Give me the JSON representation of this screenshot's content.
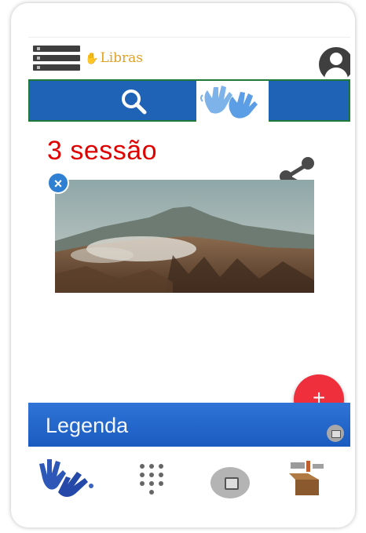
{
  "app": {
    "brand": "Libras"
  },
  "content": {
    "session_title": "3 sessão",
    "photo_alt": "volcano landscape"
  },
  "legend": {
    "label": "Legenda"
  },
  "colors": {
    "primary": "#1e63b6",
    "accent": "#ef2f3b",
    "session_text": "#e00000",
    "brand_text": "#e0a22a"
  },
  "icons": {
    "menu": "menu-icon",
    "profile": "profile-icon",
    "search": "search-icon",
    "hands": "hands-logo-icon",
    "share": "share-icon",
    "close": "close-icon",
    "add": "add-icon",
    "dialpad": "dialpad-icon",
    "image": "image-icon",
    "box": "box-icon"
  }
}
